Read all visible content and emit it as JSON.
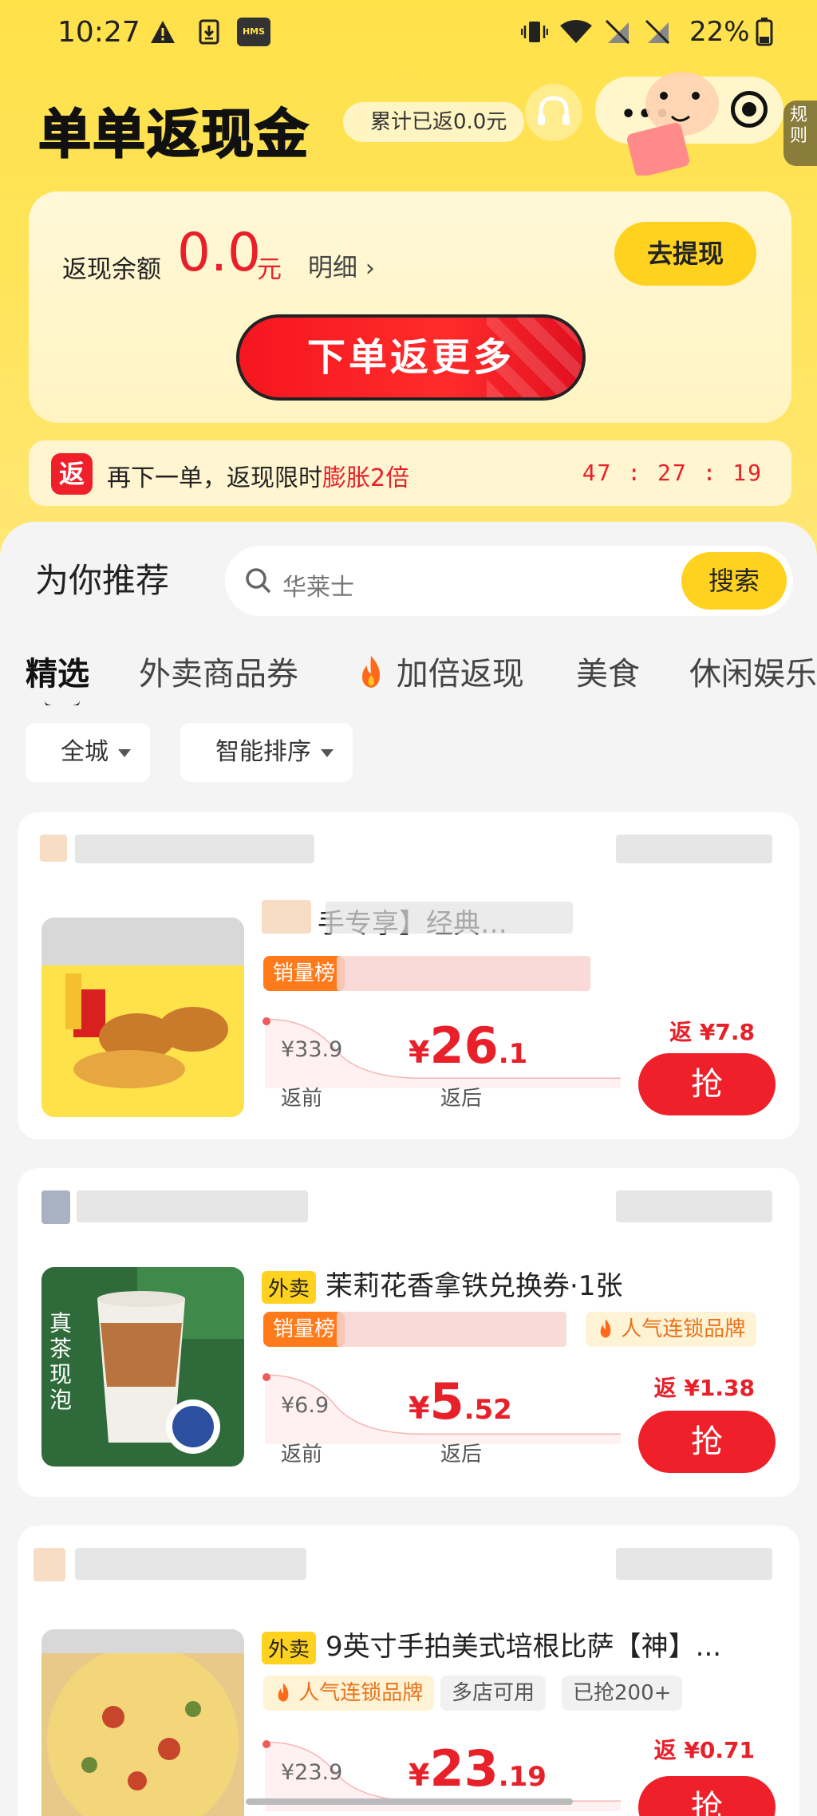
{
  "status_bar": {
    "time": "10:27",
    "battery": "22%",
    "icons": [
      "warning-icon",
      "download-icon",
      "hms-icon",
      "vibrate-icon",
      "wifi-icon",
      "no-sim-icon",
      "no-sim-icon",
      "battery-icon"
    ],
    "hms_label": "HMS"
  },
  "header": {
    "title": "单单返现金",
    "cumulative": "累计已返0.0元",
    "rules": "规则"
  },
  "balance": {
    "label": "返现余额",
    "amount": "0.0",
    "unit": "元",
    "detail": "明细",
    "withdraw": "去提现",
    "order_more": "下单返更多"
  },
  "promo": {
    "icon": "返",
    "text_prefix": "再下一单，返现限时",
    "text_highlight": "膨胀2倍",
    "countdown": "47 : 27 : 19"
  },
  "recommend": {
    "title": "为你推荐",
    "search_placeholder": "华莱士",
    "search_button": "搜索"
  },
  "tabs": [
    {
      "label": "精选"
    },
    {
      "label": "外卖商品券"
    },
    {
      "label": "加倍返现"
    },
    {
      "label": "美食"
    },
    {
      "label": "休闲娱乐"
    }
  ],
  "filters": {
    "city": "全城",
    "sort": "智能排序"
  },
  "products": [
    {
      "title": "手专享】经典…",
      "tags": [
        "销量榜"
      ],
      "price_before": "¥33.9",
      "price_after_int": "26",
      "price_after_dec": ".1",
      "label_before": "返前",
      "label_after": "返后",
      "rebate": "返 ¥7.8",
      "action": "抢"
    },
    {
      "title_tag": "外卖",
      "title": "茉莉花香拿铁兑换券·1张",
      "tags": [
        "销量榜",
        "人气连锁品牌"
      ],
      "price_before": "¥6.9",
      "price_after_int": "5",
      "price_after_dec": ".52",
      "label_before": "返前",
      "label_after": "返后",
      "rebate": "返 ¥1.38",
      "action": "抢"
    },
    {
      "title_tag": "外卖",
      "title": "9英寸手拍美式培根比萨【神】...",
      "tags": [
        "人气连锁品牌",
        "多店可用",
        "已抢200+"
      ],
      "price_before": "¥23.9",
      "price_after_int": "23",
      "price_after_dec": ".19",
      "rebate": "返 ¥0.71",
      "action": "抢"
    }
  ],
  "currency_symbol": "¥",
  "colors": {
    "accent_yellow": "#ffd21f",
    "accent_red": "#e8202a",
    "background": "#f4f4f4"
  }
}
